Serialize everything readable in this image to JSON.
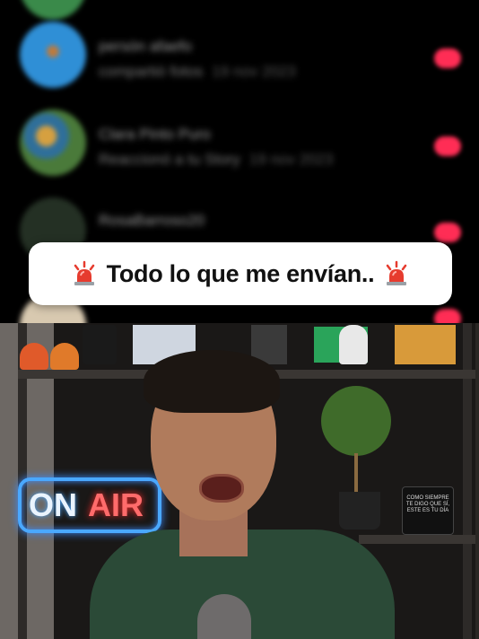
{
  "messages": [
    {
      "name": "persón afaefo",
      "subtitle": "compartió fotos",
      "time": "19 nov 2023",
      "avatar_color": "#2f8fd6"
    },
    {
      "name": "Clara Pinto Puro",
      "subtitle": "Reaccionó a tu Story",
      "time": "19 nov 2023",
      "avatar_color": "#4a7a3a"
    },
    {
      "name": "RosaBarroso20",
      "subtitle": "",
      "time": "",
      "avatar_color": "#2a3a2a"
    },
    {
      "name": "",
      "subtitle": "",
      "time": "",
      "avatar_color": "#d8c9b0"
    }
  ],
  "unread_color": "#ff2d55",
  "banner": {
    "text": "Todo lo que me envían..",
    "left_icon": "siren-icon",
    "right_icon": "siren-icon"
  },
  "video": {
    "neon_sign_on": "ON",
    "neon_sign_air": "AIR",
    "mug_text": "COMO SIEMPRE TE DIGO QUE SÍ, ESTE ES TU DÍA"
  }
}
